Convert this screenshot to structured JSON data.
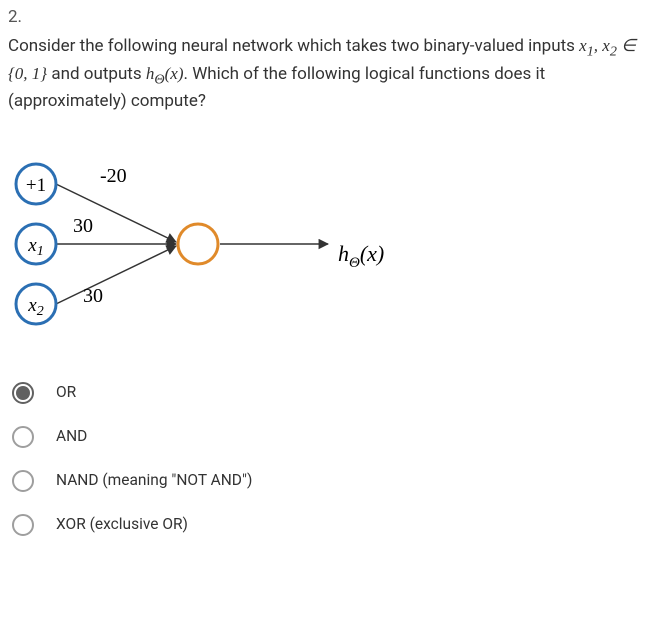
{
  "question": {
    "number": "2.",
    "stem_pre": "Consider the following neural network which takes two binary-valued inputs ",
    "stem_vars": "x₁, x₂ ∈ {0, 1}",
    "stem_mid": " and outputs ",
    "stem_h": "hΘ(x)",
    "stem_post": ". Which of the following logical functions does it (approximately) compute?"
  },
  "diagram": {
    "nodes": {
      "bias": "+1",
      "x1": "x",
      "x1_sub": "1",
      "x2": "x",
      "x2_sub": "2",
      "output_h": "h",
      "output_sub": "Θ",
      "output_arg": "(x)"
    },
    "weights": {
      "w_bias": "-20",
      "w_x1": "30",
      "w_x2": "30"
    }
  },
  "options": [
    {
      "label": "OR",
      "selected": true
    },
    {
      "label": "AND",
      "selected": false
    },
    {
      "label": "NAND (meaning \"NOT AND\")",
      "selected": false
    },
    {
      "label": "XOR (exclusive OR)",
      "selected": false
    }
  ]
}
